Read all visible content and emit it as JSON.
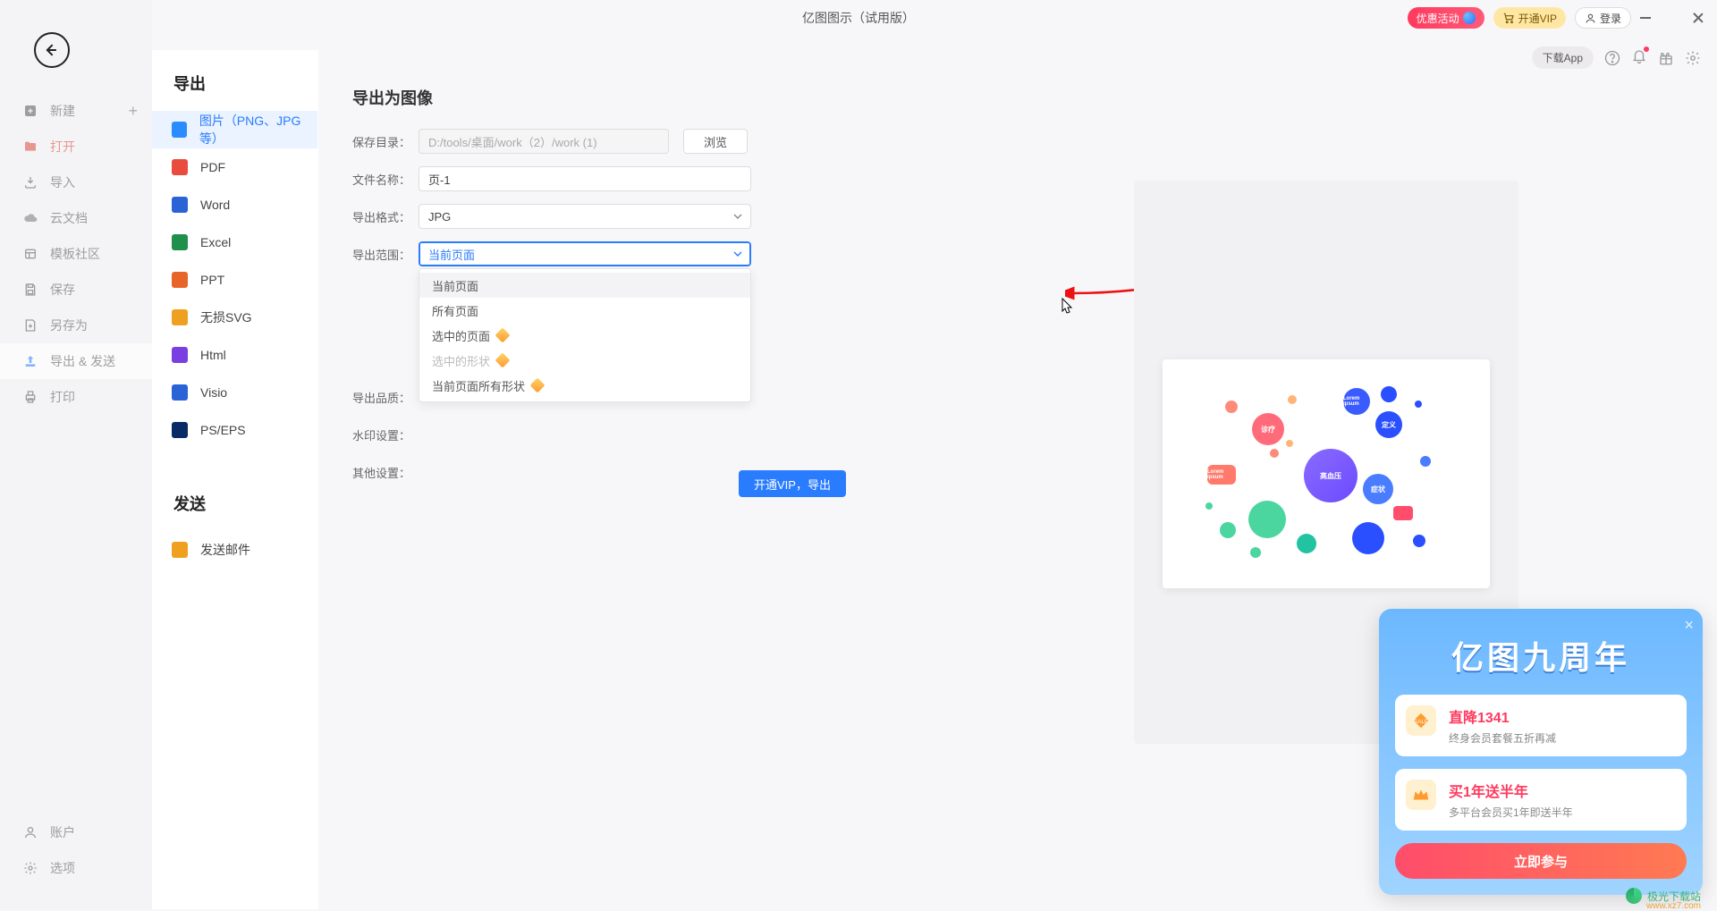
{
  "titlebar": {
    "app_title": "亿图图示（试用版）",
    "promo_pill": "优惠活动",
    "vip_pill": "开通VIP",
    "login_pill": "登录"
  },
  "toolbar2": {
    "download_app": "下载App"
  },
  "sidebar1": {
    "items": [
      {
        "label": "新建",
        "has_plus": true
      },
      {
        "label": "打开",
        "special": true
      },
      {
        "label": "导入"
      },
      {
        "label": "云文档"
      },
      {
        "label": "模板社区"
      },
      {
        "label": "保存"
      },
      {
        "label": "另存为"
      },
      {
        "label": "导出 & 发送",
        "active": true
      },
      {
        "label": "打印"
      }
    ],
    "bottom": [
      {
        "label": "账户"
      },
      {
        "label": "选项"
      }
    ]
  },
  "sidebar2": {
    "heading_export": "导出",
    "heading_send": "发送",
    "export_items": [
      {
        "label": "图片（PNG、JPG等）",
        "color": "#2a8cff",
        "active": true
      },
      {
        "label": "PDF",
        "color": "#e94b3c"
      },
      {
        "label": "Word",
        "color": "#2a63d6"
      },
      {
        "label": "Excel",
        "color": "#1f8f4e"
      },
      {
        "label": "PPT",
        "color": "#e8652a"
      },
      {
        "label": "无损SVG",
        "color": "#f0a020"
      },
      {
        "label": "Html",
        "color": "#7a3fe0"
      },
      {
        "label": "Visio",
        "color": "#2a63d6"
      },
      {
        "label": "PS/EPS",
        "color": "#0a2a66"
      }
    ],
    "send_items": [
      {
        "label": "发送邮件",
        "color": "#f0a020"
      }
    ]
  },
  "form": {
    "heading": "导出为图像",
    "save_dir_label": "保存目录：",
    "save_dir_value": "D:/tools/桌面/work（2）/work (1)",
    "browse": "浏览",
    "file_name_label": "文件名称：",
    "file_name_value": "页-1",
    "format_label": "导出格式：",
    "format_value": "JPG",
    "range_label": "导出范围：",
    "range_value": "当前页面",
    "range_options": [
      {
        "label": "当前页面"
      },
      {
        "label": "所有页面"
      },
      {
        "label": "选中的页面",
        "vip": true
      },
      {
        "label": "选中的形状",
        "vip": true,
        "disabled": true
      },
      {
        "label": "当前页面所有形状",
        "vip": true
      }
    ],
    "quality_label": "导出品质：",
    "watermark_label": "水印设置：",
    "other_label": "其他设置：",
    "vip_button": "开通VIP，导出"
  },
  "preview": {
    "center_text": "高血压",
    "labels": [
      "症状",
      "诊疗",
      "定义",
      "Lorem ipsum",
      "Lorem ipsum"
    ]
  },
  "promo": {
    "title_main": "亿图九周年",
    "card1_title": "直降1341",
    "card1_sub": "终身会员套餐五折再减",
    "card2_title": "买1年送半年",
    "card2_sub": "多平台会员买1年即送半年",
    "cta": "立即参与"
  },
  "watermark": {
    "name": "极光下载站",
    "url": "www.xz7.com"
  }
}
